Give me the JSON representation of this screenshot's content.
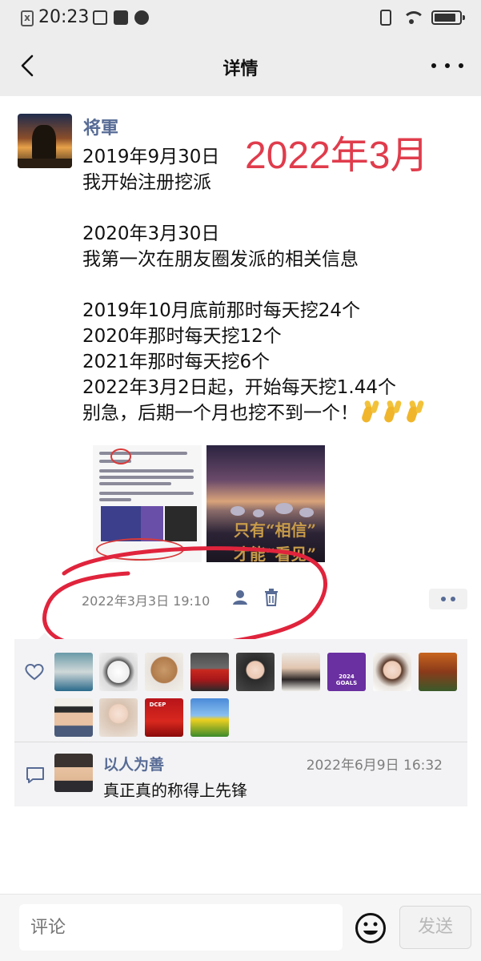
{
  "status_bar": {
    "time": "20:23",
    "notification_x": "x"
  },
  "nav": {
    "title": "详情",
    "back_icon": "chevron-left-icon",
    "more_icon": "more-dots-icon"
  },
  "post": {
    "author": "将軍",
    "overlay_date": "2022年3月",
    "lines": [
      "2019年9月30日",
      "我开始注册挖派",
      "",
      "2020年3月30日",
      "我第一次在朋友圈发派的相关信息",
      "",
      "2019年10月底前那时每天挖24个",
      "2020年那时每天挖12个",
      "2021年那时每天挖6个",
      "2022年3月2日起，开始每天挖1.44个",
      "别急，后期一个月也挖不到一个！"
    ],
    "emoji": "victory-hand-emoji",
    "image2_text_line1": "只有“相信”",
    "image2_text_line2": "才能“看见”",
    "time": "2022年3月3日 19:10",
    "annotation_color": "#e0243c"
  },
  "likes": {
    "count": 13,
    "heart_icon": "heart-outline-icon",
    "goals_badge": "2024 GOALS",
    "dcep_badge": "DCEP"
  },
  "comment": {
    "author": "以人为善",
    "time": "2022年6月9日 16:32",
    "text": "真正真的称得上先锋",
    "icon": "comment-bubble-icon"
  },
  "input": {
    "placeholder": "评论",
    "send_label": "发送",
    "emoji_icon": "smiley-icon"
  },
  "colors": {
    "link_blue": "#576b95",
    "overlay_red": "#e03c4c",
    "nav_bg": "#ededed",
    "panel_bg": "#f3f3f5"
  }
}
